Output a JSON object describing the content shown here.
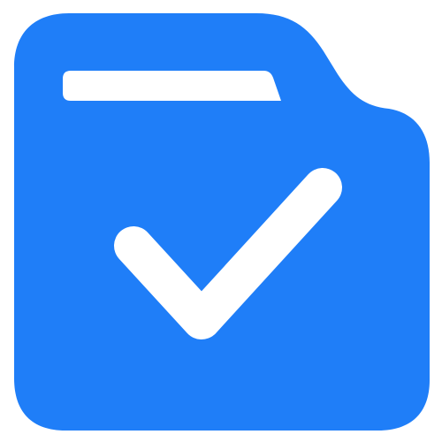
{
  "icon": {
    "name": "folder-check-icon",
    "colors": {
      "folder": "#1F7EF8",
      "tab_slot": "#FFFFFF",
      "checkmark": "#FFFFFF",
      "background": "#FFFFFF"
    }
  }
}
